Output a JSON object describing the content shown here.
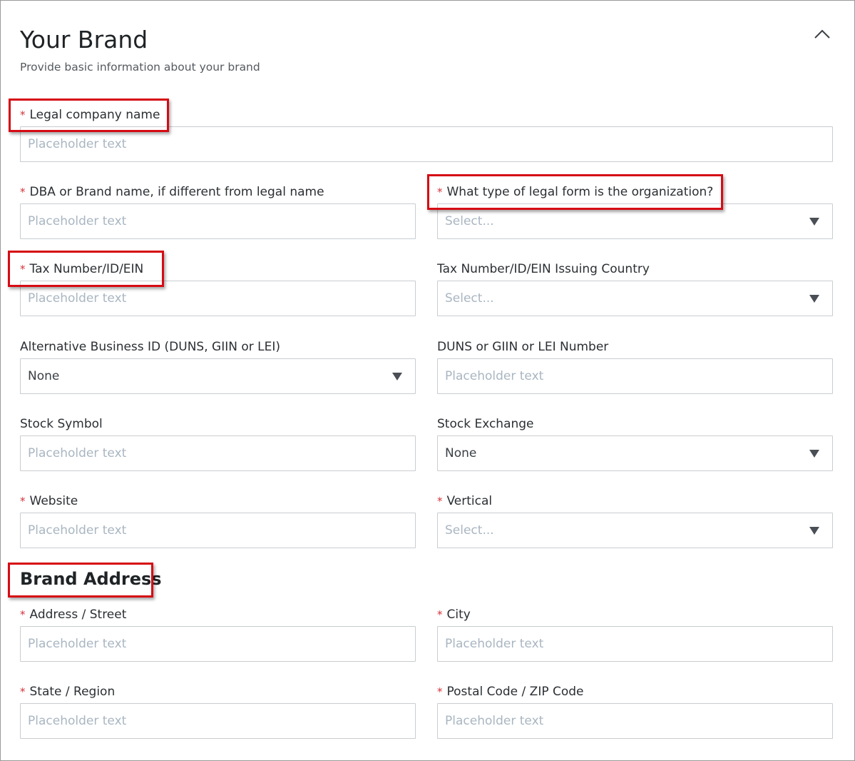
{
  "header": {
    "title": "Your Brand",
    "subtitle": "Provide basic information about your brand"
  },
  "colors": {
    "required_asterisk": "#d3343b",
    "highlight_box": "#d60b14",
    "placeholder": "#a9b6c2",
    "border": "#c9cdd1"
  },
  "fields": {
    "legal_company_name": {
      "label": "Legal company name",
      "required": "*",
      "placeholder": "Placeholder text"
    },
    "dba_name": {
      "label": "DBA or Brand name, if different from legal name",
      "required": "*",
      "placeholder": "Placeholder text"
    },
    "legal_form": {
      "label": "What type of legal form is the organization?",
      "required": "*",
      "value": "Select..."
    },
    "tax_number": {
      "label": "Tax Number/ID/EIN",
      "required": "*",
      "placeholder": "Placeholder text"
    },
    "tax_country": {
      "label": "Tax Number/ID/EIN Issuing Country",
      "value": "Select..."
    },
    "alt_business_id": {
      "label": "Alternative Business ID (DUNS, GIIN or LEI)",
      "value": "None"
    },
    "duns_number": {
      "label": "DUNS or GIIN or LEI Number",
      "placeholder": "Placeholder text"
    },
    "stock_symbol": {
      "label": "Stock Symbol",
      "placeholder": "Placeholder text"
    },
    "stock_exchange": {
      "label": "Stock Exchange",
      "value": "None"
    },
    "website": {
      "label": "Website",
      "required": "*",
      "placeholder": "Placeholder text"
    },
    "vertical": {
      "label": "Vertical",
      "required": "*",
      "value": "Select..."
    }
  },
  "address": {
    "section_title": "Brand Address",
    "street": {
      "label": "Address / Street",
      "required": "*",
      "placeholder": "Placeholder text"
    },
    "city": {
      "label": "City",
      "required": "*",
      "placeholder": "Placeholder text"
    },
    "state": {
      "label": "State / Region",
      "required": "*",
      "placeholder": "Placeholder text"
    },
    "postal": {
      "label": "Postal Code / ZIP Code",
      "required": "*",
      "placeholder": "Placeholder text"
    }
  },
  "icons": {
    "collapse": "chevron-up-icon",
    "dropdown": "caret-down-icon"
  }
}
